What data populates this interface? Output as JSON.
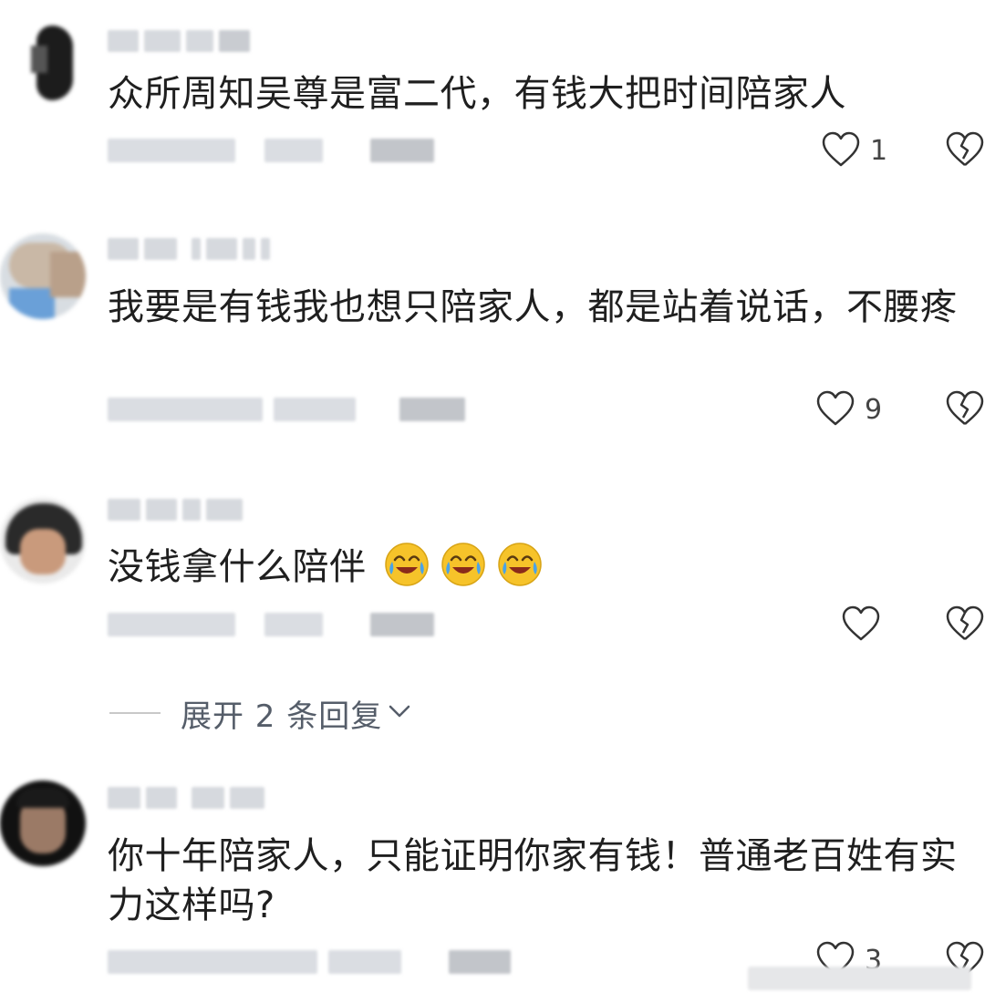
{
  "comments": [
    {
      "text": "众所周知吴尊是富二代，有钱大把时间陪家人",
      "likes": "1",
      "avatar": "dark",
      "emoji_count": 0
    },
    {
      "text": "我要是有钱我也想只陪家人，都是站着说话，不腰疼",
      "likes": "9",
      "avatar": "light",
      "emoji_count": 0
    },
    {
      "text": "没钱拿什么陪伴",
      "likes": "",
      "avatar": "hair",
      "emoji_count": 3,
      "emoji_icon": "laughing-crying-emoji"
    },
    {
      "text": "你十年陪家人，只能证明你家有钱！普通老百姓有实力这样吗?",
      "likes": "3",
      "avatar": "man",
      "emoji_count": 0
    }
  ],
  "expand_replies": {
    "label": "展开 2 条回复"
  },
  "icons": {
    "like": "heart-outline-icon",
    "dislike": "broken-heart-icon",
    "expand": "chevron-down-icon"
  },
  "colors": {
    "text": "#1f1f1f",
    "secondary": "#555d69",
    "icon": "#333333",
    "emoji_face": "#f6c32a"
  }
}
